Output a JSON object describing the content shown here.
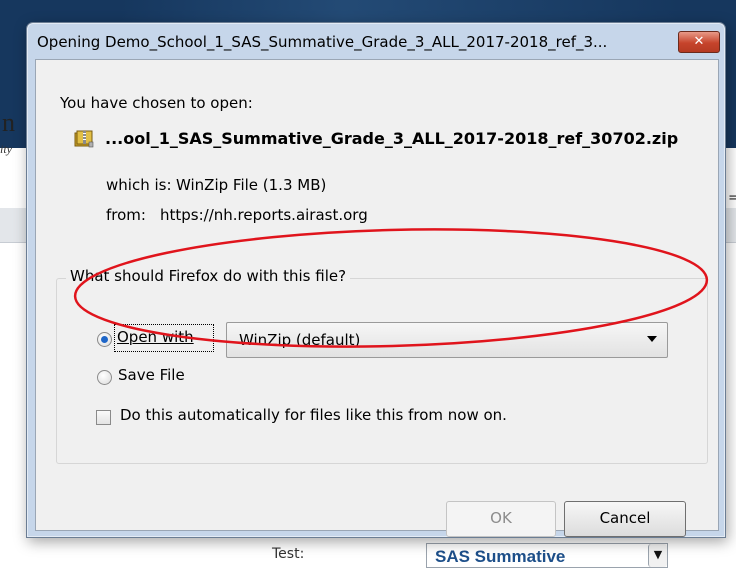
{
  "background": {
    "page_letter": "n",
    "page_italic": "ity",
    "right_char": "=",
    "test_label": "Test:",
    "test_select_value": "SAS Summative",
    "test_select_arrow": "▼"
  },
  "dialog": {
    "title": "Opening Demo_School_1_SAS_Summative_Grade_3_ALL_2017-2018_ref_3...",
    "close_glyph": "✕",
    "intro": "You have chosen to open:",
    "file_name": "...ool_1_SAS_Summative_Grade_3_ALL_2017-2018_ref_30702.zip",
    "which_is_label": "which is:",
    "which_is_value": "WinZip File (1.3 MB)",
    "from_label": "from:",
    "from_value": "https://nh.reports.airast.org",
    "group_title": "What should Firefox do with this file?",
    "open_with_label": "Open with",
    "open_with_selected": "WinZip (default)",
    "save_file_label": "Save File",
    "auto_label": "Do this automatically for files like this from now on.",
    "ok_label": "OK",
    "cancel_label": "Cancel"
  },
  "icons": {
    "file": "zip-archive-icon",
    "dropdown": "chevron-down-icon",
    "close": "close-icon"
  },
  "colors": {
    "annotation_ellipse": "#e0141c",
    "radio_selected": "#1e66c8"
  }
}
